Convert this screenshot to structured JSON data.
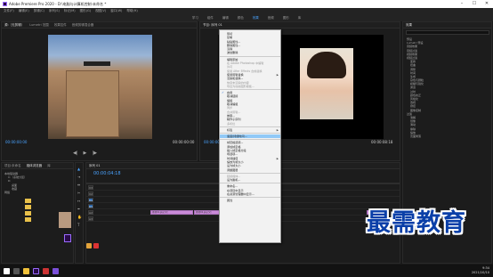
{
  "title": "Adobe Premiere Pro 2020 - D:\\电脑与计算机控制-未命名 *",
  "menu": [
    "文件(F)",
    "编辑(E)",
    "剪辑(C)",
    "序列(S)",
    "标记(M)",
    "图形(G)",
    "视图(V)",
    "窗口(W)",
    "帮助(H)"
  ],
  "workspaces": [
    "学习",
    "组件",
    "编辑",
    "颜色",
    "效果",
    "音频",
    "图形",
    "库"
  ],
  "active_workspace": "效果",
  "source": {
    "tabs": [
      "源:（无剪辑）",
      "Lumetri 范围",
      "效果控件",
      "音频剪辑混合器"
    ],
    "timecode": "00:00:00:00",
    "timecode_end": "00:00:00:00"
  },
  "program": {
    "tab": "节目: 序列 01",
    "timecode": "00:00:00:00",
    "timecode_end": "00:00:08:18"
  },
  "timeline": {
    "tab": "序列 01",
    "timecode": "00:00:04:18",
    "tracks": [
      "V3",
      "V2",
      "V1",
      "A1",
      "A2",
      "A3"
    ],
    "clips": [
      {
        "label": "素材01.jpg [V]",
        "track": "V1"
      },
      {
        "label": "素材02.jpg [V]",
        "track": "V1"
      },
      {
        "label": "素材03.jpg",
        "track": "V1"
      }
    ]
  },
  "project": {
    "tabs": [
      "项目:未命名",
      "媒体浏览器",
      "库",
      "信息",
      "效果"
    ],
    "items": [
      "本地驱动器",
      "C:（系统分区）",
      "D:",
      "桌面",
      "收藏",
      "网络"
    ]
  },
  "effects": {
    "tab": "效果",
    "items": [
      "预设",
      "Lumetri 预设",
      "音频效果",
      "音频过渡",
      "视频效果",
      "视频过渡",
      "变换",
      "扭曲",
      "调整",
      "时间",
      "生成",
      "杂色与颗粒",
      "模糊与锐化",
      "通道",
      "过时",
      "颜色校正",
      "风格化",
      "透视",
      "键控",
      "图像控制",
      "过渡",
      "溶解",
      "划像",
      "滑动",
      "擦除",
      "缩放",
      "页面剥落"
    ]
  },
  "context_menu": [
    {
      "label": "剪切",
      "type": "item"
    },
    {
      "label": "复制",
      "type": "item"
    },
    {
      "label": "粘贴属性...",
      "type": "item"
    },
    {
      "label": "删除属性...",
      "type": "item"
    },
    {
      "label": "清除",
      "type": "item"
    },
    {
      "label": "波纹删除",
      "type": "item"
    },
    {
      "type": "sep"
    },
    {
      "label": "编辑原始",
      "type": "item"
    },
    {
      "label": "在 Adobe Photoshop 中编辑",
      "type": "disabled"
    },
    {
      "label": "许可",
      "type": "disabled"
    },
    {
      "label": "使用 After Effects 合成替换",
      "type": "disabled"
    },
    {
      "label": "使用剪辑替换",
      "type": "submenu"
    },
    {
      "label": "渲染和替换...",
      "type": "item"
    },
    {
      "label": "恢复未渲染的内容",
      "type": "disabled"
    },
    {
      "label": "导出为动态图形模板...",
      "type": "disabled"
    },
    {
      "type": "sep"
    },
    {
      "label": "启用",
      "type": "checked"
    },
    {
      "label": "取消链接",
      "type": "item"
    },
    {
      "label": "编组",
      "type": "item"
    },
    {
      "label": "取消编组",
      "type": "item"
    },
    {
      "label": "同步",
      "type": "disabled"
    },
    {
      "label": "合并剪辑...",
      "type": "disabled"
    },
    {
      "label": "嵌套...",
      "type": "item"
    },
    {
      "label": "制作子序列",
      "type": "item"
    },
    {
      "label": "多机位",
      "type": "disabled"
    },
    {
      "type": "sep"
    },
    {
      "label": "标签",
      "type": "submenu"
    },
    {
      "type": "sep"
    },
    {
      "label": "速度/持续时间...",
      "type": "highlight"
    },
    {
      "type": "sep"
    },
    {
      "label": "帧定格选项...",
      "type": "item"
    },
    {
      "label": "添加帧定格",
      "type": "item"
    },
    {
      "label": "插入帧定格分段",
      "type": "item"
    },
    {
      "label": "场选项...",
      "type": "item"
    },
    {
      "label": "时间插值",
      "type": "submenu"
    },
    {
      "label": "缩放为帧大小",
      "type": "item"
    },
    {
      "label": "设为帧大小",
      "type": "item"
    },
    {
      "label": "调整图层",
      "type": "item"
    },
    {
      "type": "sep"
    },
    {
      "label": "链接媒体...",
      "type": "disabled"
    },
    {
      "label": "设为脱机...",
      "type": "item"
    },
    {
      "type": "sep"
    },
    {
      "label": "重命名...",
      "type": "item"
    },
    {
      "label": "在项目中显示",
      "type": "item"
    },
    {
      "label": "在资源管理器中显示...",
      "type": "item"
    },
    {
      "type": "sep"
    },
    {
      "label": "属性",
      "type": "item"
    }
  ],
  "watermark": "最需教育",
  "clock": {
    "time": "9:34",
    "date": "2021/10/10"
  },
  "colors": {
    "accent": "#4aa3ff",
    "clip": "#c98ad8",
    "menu_highlight": "#91c9f7",
    "watermark": "#0a3fa8"
  }
}
